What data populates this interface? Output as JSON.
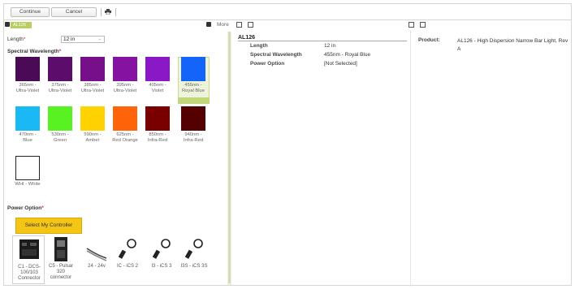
{
  "toolbar": {
    "continue_label": "Continue",
    "cancel_label": "Cancel",
    "print_icon": "printer-icon"
  },
  "left_panel": {
    "badge": "AL126",
    "more_label": "More",
    "length_label": "Length",
    "length_value": "12 in",
    "spectral_label": "Spectral Wavelength",
    "swatches": [
      {
        "line1": "365nm -",
        "line2": "Ultra-Violet",
        "color": "#4b0a55"
      },
      {
        "line1": "375nm -",
        "line2": "Ultra-Violet",
        "color": "#5c0c6a"
      },
      {
        "line1": "385nm -",
        "line2": "Ultra-Violet",
        "color": "#780f8a"
      },
      {
        "line1": "395nm -",
        "line2": "Ultra-Violet",
        "color": "#8512a0"
      },
      {
        "line1": "405nm -",
        "line2": "Violet",
        "color": "#8a18c6"
      },
      {
        "line1": "455nm -",
        "line2": "Royal Blue",
        "color": "#1464fa"
      },
      {
        "line1": "470nm -",
        "line2": "Blue",
        "color": "#1ab9f5"
      },
      {
        "line1": "530nm -",
        "line2": "Green",
        "color": "#58f223"
      },
      {
        "line1": "590nm -",
        "line2": "Amber",
        "color": "#ffd200"
      },
      {
        "line1": "625nm -",
        "line2": "Red Orange",
        "color": "#ff640a"
      },
      {
        "line1": "850nm -",
        "line2": "Infra-Red",
        "color": "#7a0000"
      },
      {
        "line1": "940nm -",
        "line2": "Infra-Red",
        "color": "#540000"
      },
      {
        "line1": "WHI - White",
        "line2": "",
        "color": "#ffffff"
      }
    ],
    "power_label": "Power Option",
    "select_controller_label": "Select My Controller",
    "power_options": [
      {
        "line1": "C1 - DCS-",
        "line2": "100/103",
        "line3": "Connector"
      },
      {
        "line1": "C5 - Pulsar",
        "line2": "320",
        "line3": "connector"
      },
      {
        "line1": "24 - 24v",
        "line2": "",
        "line3": ""
      },
      {
        "line1": "IC - iCS 2",
        "line2": "",
        "line3": ""
      },
      {
        "line1": "I3 - iCS 3",
        "line2": "",
        "line3": ""
      },
      {
        "line1": "I3S - iCS 3S",
        "line2": "",
        "line3": ""
      }
    ]
  },
  "summary": {
    "title": "AL126",
    "rows": [
      {
        "label": "Length",
        "value": "12 in"
      },
      {
        "label": "Spectral Wavelength",
        "value": "455nm - Royal Blue"
      },
      {
        "label": "Power Option",
        "value": "[Not Selected]"
      }
    ]
  },
  "product": {
    "label": "Product:",
    "value": "AL126 - High Dispersion Narrow Bar Light, Rev A"
  },
  "colors": {
    "accent_green": "#b6cf5f",
    "button_yellow": "#f4c514",
    "required": "#c0392b"
  }
}
